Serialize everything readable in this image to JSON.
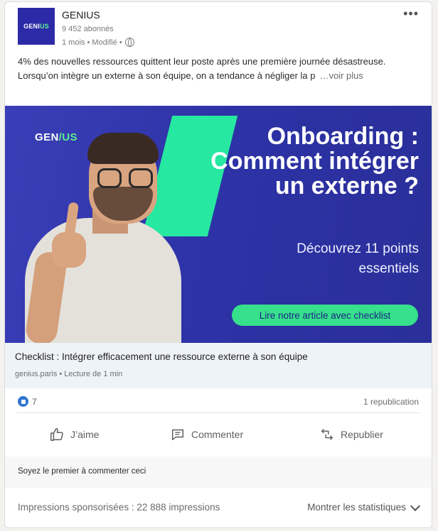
{
  "post": {
    "author": "GENIUS",
    "followers": "9 452 abonnés",
    "meta": "1 mois • Modifié •",
    "logo_text_a": "GENI",
    "logo_text_b": "US",
    "text_line1": "4% des nouvelles ressources quittent leur poste après une première journée désastreuse.",
    "text_line2": "Lorsqu’on intègre un externe à son équipe, on a tendance à négliger la p",
    "see_more": "…voir plus"
  },
  "banner": {
    "logo_a": "GEN",
    "logo_b": "/US",
    "headline": "Onboarding : Comment intégrer un externe ?",
    "subline": "Découvrez 11 points essentiels",
    "cta": "Lire notre article avec checklist"
  },
  "article": {
    "title": "Checklist : Intégrer efficacement une ressource externe à son équipe",
    "source": "genius.paris • Lecture de 1 min"
  },
  "counts": {
    "likes": "7",
    "republications": "1 republication"
  },
  "actions": {
    "like": "J’aime",
    "comment": "Commenter",
    "repost": "Republier"
  },
  "comments": {
    "prompt": "Soyez le premier à commenter ceci"
  },
  "footer": {
    "impressions": "Impressions sponsorisées : 22 888 impressions",
    "stats": "Montrer les statistiques"
  },
  "colors": {
    "brand": "#2d2aa8",
    "accent_green": "#36e08c",
    "link_blue": "#2f74d0"
  },
  "icons": [
    "more-icon",
    "globe-icon",
    "like-reaction-icon",
    "thumbs-up-icon",
    "comment-icon",
    "repost-icon",
    "chevron-down-icon"
  ]
}
